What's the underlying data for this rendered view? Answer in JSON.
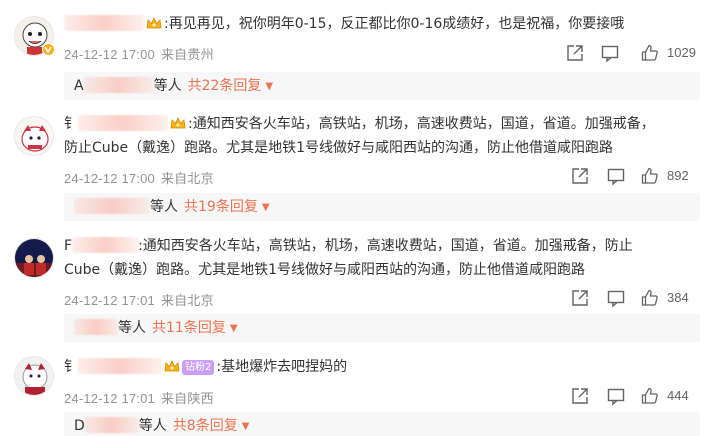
{
  "comments": [
    {
      "nickname_lead": "",
      "rank_badge": "",
      "content": ":再见再见，祝你明年0-15，反正都比你0-16成绩好，也是祝福，你要接哦",
      "content_line2": "",
      "date": "24-12-12 17:00",
      "source": "来自贵州",
      "likes": "1029",
      "reply_lead": "A",
      "reply_who": "等人",
      "reply_more": "共22条回复"
    },
    {
      "nickname_lead": "钅",
      "rank_badge": "",
      "content": ":通知西安各火车站，高铁站，机场，高速收费站，国道，省道。加强戒备，",
      "content_line2": "防止Cube（戴逸）跑路。尤其是地铁1号线做好与咸阳西站的沟通，防止他借道咸阳跑路",
      "date": "24-12-12 17:00",
      "source": "来自北京",
      "likes": "892",
      "reply_lead": "",
      "reply_who": "等人",
      "reply_more": "共19条回复"
    },
    {
      "nickname_lead": "F",
      "rank_badge": "",
      "content": ":通知西安各火车站，高铁站，机场，高速收费站，国道，省道。加强戒备，防止",
      "content_line2": "Cube（戴逸）跑路。尤其是地铁1号线做好与咸阳西站的沟通，防止他借道咸阳跑路",
      "date": "24-12-12 17:01",
      "source": "来自北京",
      "likes": "384",
      "reply_lead": "",
      "reply_who": "等人",
      "reply_more": "共11条回复"
    },
    {
      "nickname_lead": "钅",
      "rank_badge": "钻粉2",
      "content": ":基地爆炸去吧捏妈的",
      "content_line2": "",
      "date": "24-12-12 17:01",
      "source": "来自陕西",
      "likes": "444",
      "reply_lead": "D",
      "reply_who": "等人",
      "reply_more": "共8条回复"
    }
  ],
  "colors": {
    "accent": "#eb7350",
    "meta": "#939393",
    "reply_bg": "#f7f7f7",
    "crown": "#f6b21b"
  },
  "icons": {
    "share": "share-icon",
    "comment": "comment-icon",
    "like": "thumbs-up-icon",
    "crown": "crown-icon",
    "vip": "vip-badge-icon"
  }
}
